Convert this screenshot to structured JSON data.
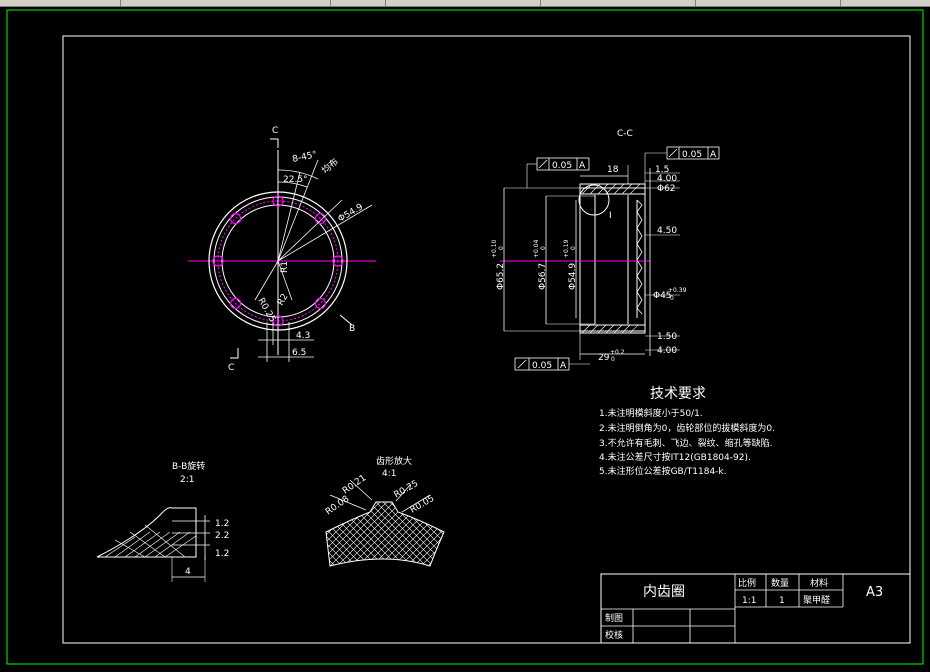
{
  "front_view": {
    "section_mark": "C",
    "angle_8x45": "8-45°",
    "uniform_label": "均布",
    "angle_22": "22.5°",
    "dia_549": "Φ54.9",
    "r025": "R0.25",
    "r2": "R2",
    "r1": "R1",
    "dim_43": "4.3",
    "dim_65": "6.5",
    "section_b": "B"
  },
  "section_view": {
    "title": "C-C",
    "tol_top": "0.05",
    "tol_top_datum": "A",
    "tol_left": "0.05",
    "tol_left_datum": "A",
    "tol_bottom": "0.05",
    "tol_bottom_datum": "A",
    "dim_18": "18",
    "dim_15": "1.5",
    "dim_400a": "4.00",
    "dim_phi62": "Φ62",
    "dim_450": "4.50",
    "dim_phi45": "Φ45",
    "dim_phi45_tol": "+0.39",
    "dim_phi45_tol2": "0",
    "dim_150": "1.50",
    "dim_400b": "4.00",
    "dim_29": "29",
    "dim_29_tol": "+0.2",
    "dim_29_tol2": "0",
    "dim_652": "Φ65.2",
    "dim_567": "Φ56.7",
    "dim_549": "Φ54.9",
    "tol_652": "+0.10",
    "tol_567": "+0.04",
    "tol_549": "+0.19",
    "tol_zero": "0",
    "detail_circle_label": "I",
    "datum_a": "A"
  },
  "requirements": {
    "title": "技术要求",
    "items": [
      "1.未注明模斜度小于50/1.",
      "2.未注明倒角为0，齿轮部位的拔模斜度为0.",
      "3.不允许有毛刺、飞边、裂纹、缩孔等缺陷.",
      "4.未注公差尺寸按IT12(GB1804-92).",
      "5.未注形位公差按GB/T1184-k."
    ]
  },
  "detail_b": {
    "title": "B-B旋转",
    "scale": "2:1",
    "dim_12a": "1.2",
    "dim_22": "2.2",
    "dim_12b": "1.2",
    "dim_4": "4"
  },
  "detail_i": {
    "title": "齿形放大",
    "scale": "4:1",
    "r021": "R0.21",
    "r025": "R0.25",
    "r008": "R0.08",
    "r005": "R0.05"
  },
  "title_block": {
    "part_name": "内齿圈",
    "h_scale": "比例",
    "h_qty": "数量",
    "h_material": "材料",
    "scale": "1:1",
    "qty": "1",
    "material": "聚甲醛",
    "sheet": "A3",
    "drawn": "制图",
    "checked": "校核"
  }
}
